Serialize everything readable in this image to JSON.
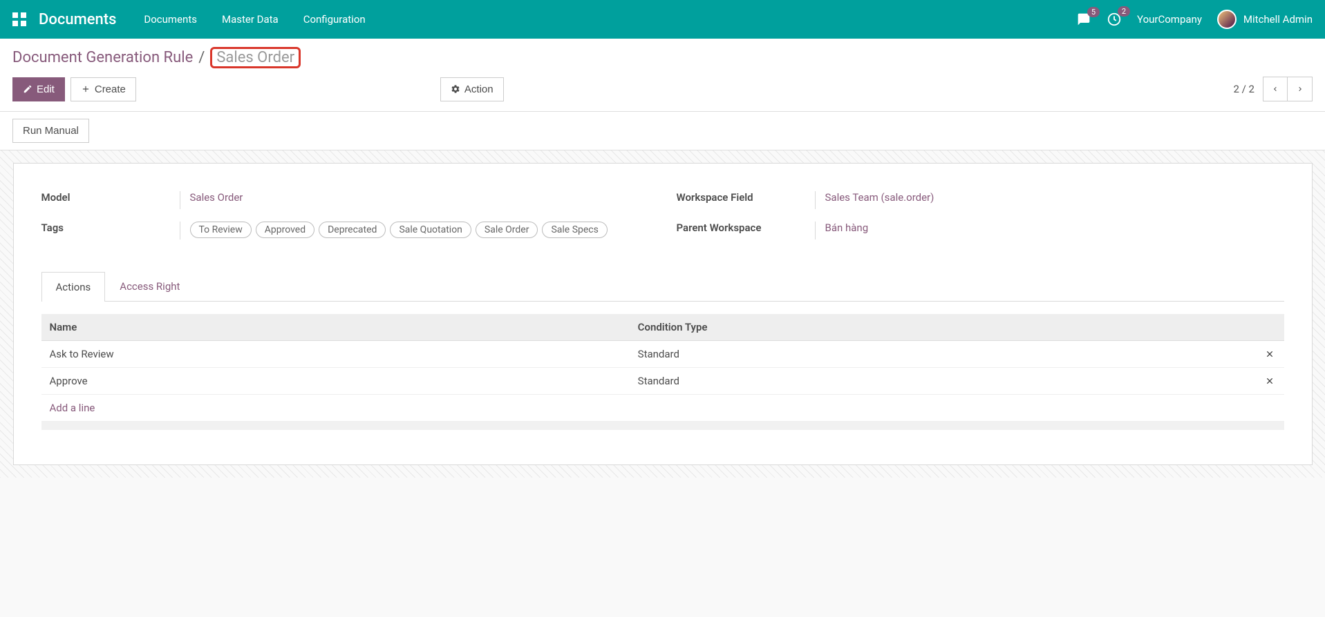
{
  "navbar": {
    "brand": "Documents",
    "links": [
      "Documents",
      "Master Data",
      "Configuration"
    ],
    "messages_badge": "5",
    "activities_badge": "2",
    "company": "YourCompany",
    "user": "Mitchell Admin"
  },
  "breadcrumb": {
    "parent": "Document Generation Rule",
    "current": "Sales Order"
  },
  "buttons": {
    "edit": "Edit",
    "create": "Create",
    "action": "Action",
    "run_manual": "Run Manual"
  },
  "pager": {
    "counter": "2 / 2"
  },
  "form": {
    "model_label": "Model",
    "model_value": "Sales Order",
    "tags_label": "Tags",
    "tags": [
      "To Review",
      "Approved",
      "Deprecated",
      "Sale Quotation",
      "Sale Order",
      "Sale Specs"
    ],
    "workspace_field_label": "Workspace Field",
    "workspace_field_value": "Sales Team (sale.order)",
    "parent_workspace_label": "Parent Workspace",
    "parent_workspace_value": "Bán hàng"
  },
  "tabs": [
    "Actions",
    "Access Right"
  ],
  "table": {
    "headers": [
      "Name",
      "Condition Type"
    ],
    "rows": [
      {
        "name": "Ask to Review",
        "cond": "Standard"
      },
      {
        "name": "Approve",
        "cond": "Standard"
      }
    ],
    "add_line": "Add a line"
  }
}
